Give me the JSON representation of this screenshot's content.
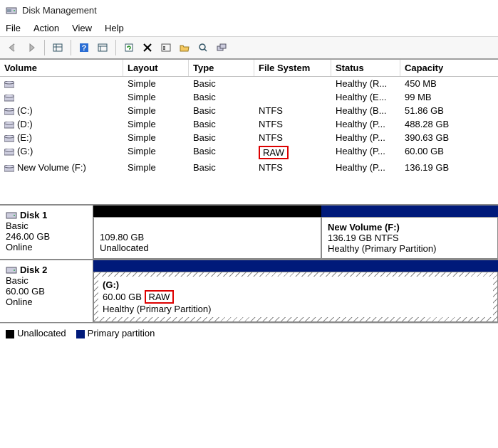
{
  "window": {
    "title": "Disk Management"
  },
  "menu": {
    "file": "File",
    "action": "Action",
    "view": "View",
    "help": "Help"
  },
  "columns": {
    "volume": "Volume",
    "layout": "Layout",
    "type": "Type",
    "filesystem": "File System",
    "status": "Status",
    "capacity": "Capacity"
  },
  "volumes": [
    {
      "name": "",
      "layout": "Simple",
      "type": "Basic",
      "fs": "",
      "status": "Healthy (R...",
      "cap": "450 MB"
    },
    {
      "name": "",
      "layout": "Simple",
      "type": "Basic",
      "fs": "",
      "status": "Healthy (E...",
      "cap": "99 MB"
    },
    {
      "name": "(C:)",
      "layout": "Simple",
      "type": "Basic",
      "fs": "NTFS",
      "status": "Healthy (B...",
      "cap": "51.86 GB"
    },
    {
      "name": "(D:)",
      "layout": "Simple",
      "type": "Basic",
      "fs": "NTFS",
      "status": "Healthy (P...",
      "cap": "488.28 GB"
    },
    {
      "name": "(E:)",
      "layout": "Simple",
      "type": "Basic",
      "fs": "NTFS",
      "status": "Healthy (P...",
      "cap": "390.63 GB"
    },
    {
      "name": "(G:)",
      "layout": "Simple",
      "type": "Basic",
      "fs": "RAW",
      "status": "Healthy (P...",
      "cap": "60.00 GB",
      "highlight_fs": true
    },
    {
      "name": "New Volume (F:)",
      "layout": "Simple",
      "type": "Basic",
      "fs": "NTFS",
      "status": "Healthy (P...",
      "cap": "136.19 GB"
    }
  ],
  "disk1": {
    "label": "Disk 1",
    "type": "Basic",
    "size": "246.00 GB",
    "state": "Online",
    "unalloc": {
      "size": "109.80 GB",
      "label": "Unallocated"
    },
    "vol": {
      "title": "New Volume  (F:)",
      "l2": "136.19 GB NTFS",
      "l3": "Healthy (Primary Partition)"
    }
  },
  "disk2": {
    "label": "Disk 2",
    "type": "Basic",
    "size": "60.00 GB",
    "state": "Online",
    "vol": {
      "title": "(G:)",
      "l2a": "60.00 GB ",
      "l2b": "RAW",
      "l3": "Healthy (Primary Partition)"
    }
  },
  "legend": {
    "unalloc": "Unallocated",
    "primary": "Primary partition"
  }
}
